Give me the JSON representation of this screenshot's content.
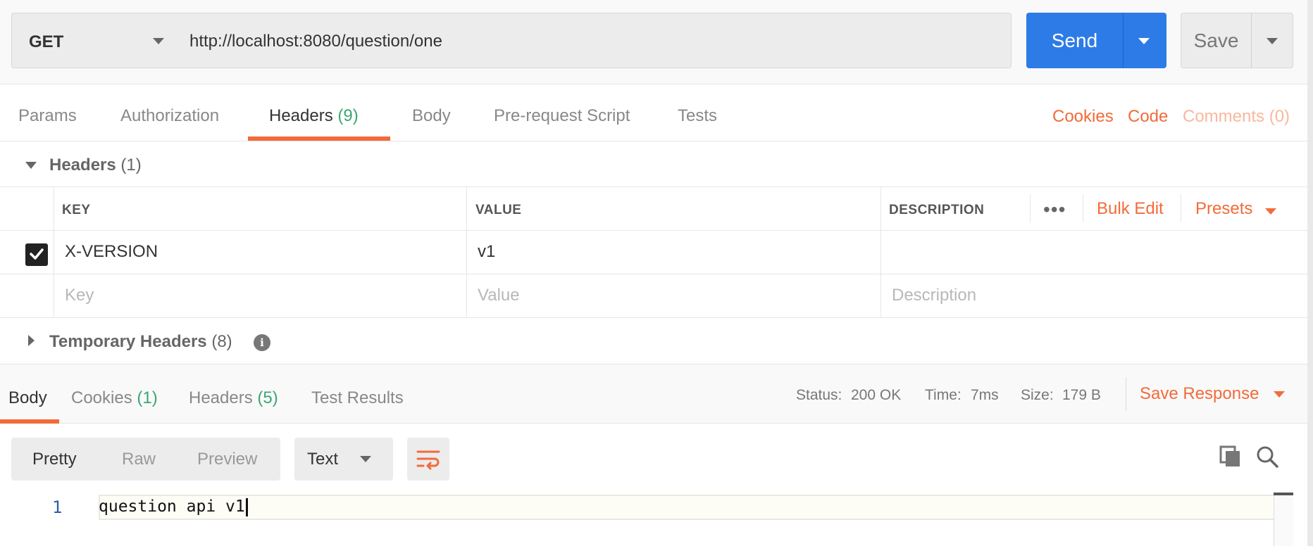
{
  "request": {
    "method": "GET",
    "url": "http://localhost:8080/question/one",
    "send_label": "Send",
    "save_label": "Save"
  },
  "request_tabs": [
    {
      "label": "Params",
      "count": ""
    },
    {
      "label": "Authorization",
      "count": ""
    },
    {
      "label": "Headers",
      "count": "(9)"
    },
    {
      "label": "Body",
      "count": ""
    },
    {
      "label": "Pre-request Script",
      "count": ""
    },
    {
      "label": "Tests",
      "count": ""
    }
  ],
  "active_request_tab": "Headers",
  "right_links": {
    "cookies": "Cookies",
    "code": "Code",
    "comments": "Comments (0)"
  },
  "headers_section": {
    "title": "Headers",
    "count": "(1)",
    "columns": {
      "key": "KEY",
      "value": "VALUE",
      "description": "DESCRIPTION"
    },
    "more_icon": "ellipsis-icon",
    "bulk_edit": "Bulk Edit",
    "presets": "Presets",
    "rows": [
      {
        "checked": true,
        "key": "X-VERSION",
        "value": "v1",
        "description": ""
      }
    ],
    "placeholders": {
      "key": "Key",
      "value": "Value",
      "description": "Description"
    }
  },
  "temporary_headers": {
    "title": "Temporary Headers",
    "count": "(8)",
    "info_icon": "info-icon"
  },
  "response_tabs": [
    {
      "label": "Body",
      "count": ""
    },
    {
      "label": "Cookies",
      "count": "(1)"
    },
    {
      "label": "Headers",
      "count": "(5)"
    },
    {
      "label": "Test Results",
      "count": ""
    }
  ],
  "active_response_tab": "Body",
  "response_status": {
    "status_label": "Status:",
    "status_value": "200 OK",
    "time_label": "Time:",
    "time_value": "7ms",
    "size_label": "Size:",
    "size_value": "179 B",
    "save_response": "Save Response"
  },
  "body_view": {
    "modes": [
      "Pretty",
      "Raw",
      "Preview"
    ],
    "active_mode": "Pretty",
    "format": "Text",
    "wrap_icon": "wrap-lines-icon",
    "copy_icon": "copy-icon",
    "search_icon": "search-icon"
  },
  "editor": {
    "lines": [
      {
        "number": "1",
        "text": "question api v1"
      }
    ]
  },
  "colors": {
    "accent": "#f26b3a",
    "primary_button": "#2d7be6",
    "success": "#3aa772"
  }
}
